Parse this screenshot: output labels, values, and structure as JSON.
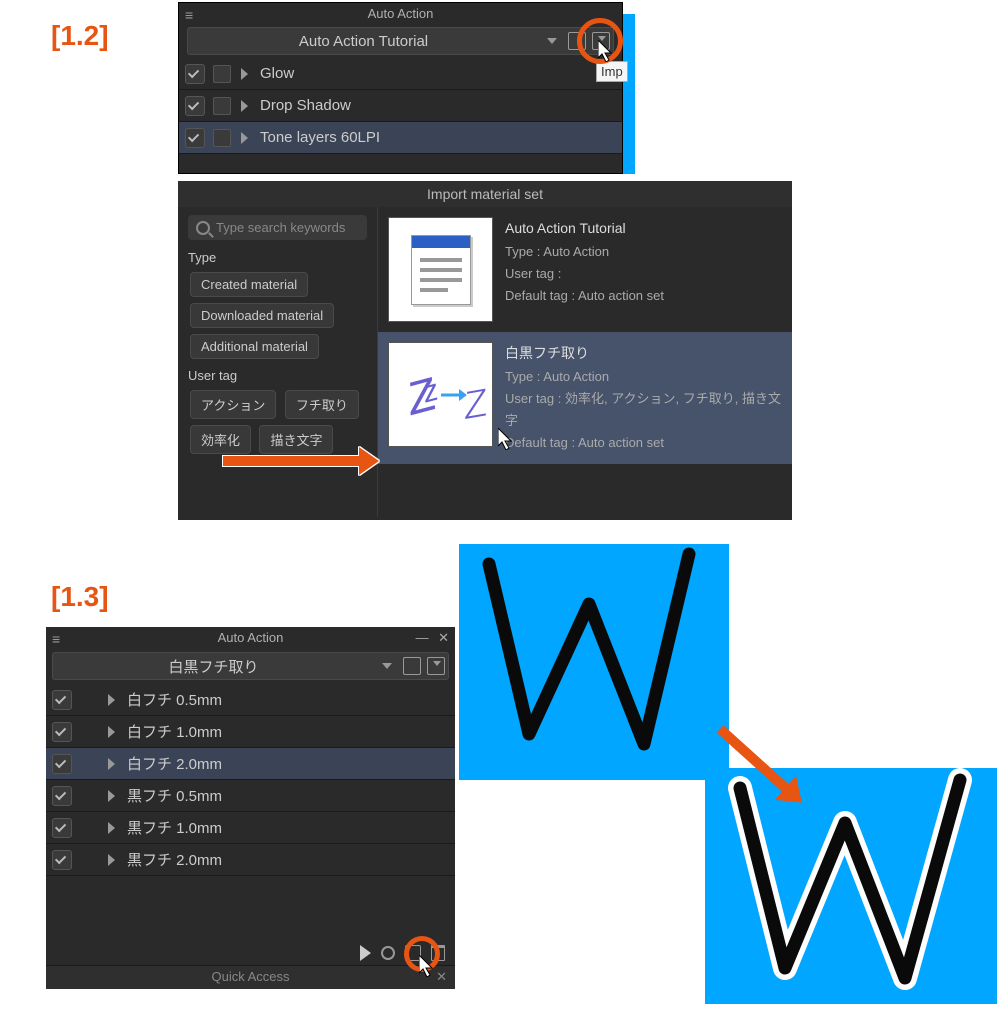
{
  "labels": {
    "step12": "[1.2]",
    "step13": "[1.3]"
  },
  "panel1": {
    "title": "Auto Action",
    "dropdown": "Auto Action Tutorial",
    "import_tooltip": "Imp",
    "rows": [
      "Glow",
      "Drop Shadow",
      "Tone layers 60LPI"
    ]
  },
  "panel2": {
    "title": "Import material set",
    "search_placeholder": "Type search keywords",
    "type_label": "Type",
    "type_tags": [
      "Created material",
      "Downloaded material",
      "Additional material"
    ],
    "usertag_label": "User tag",
    "user_tags": [
      "アクション",
      "フチ取り",
      "効率化",
      "描き文字"
    ],
    "materials": [
      {
        "title": "Auto Action Tutorial",
        "type": "Type : Auto Action",
        "usertag": "User tag :",
        "default": "Default tag : Auto action set"
      },
      {
        "title": "白黒フチ取り",
        "type": "Type : Auto Action",
        "usertag": "User tag : 効率化, アクション, フチ取り, 描き文字",
        "default": "Default tag : Auto action set"
      }
    ]
  },
  "panel3": {
    "title": "Auto Action",
    "dropdown": "白黒フチ取り",
    "rows": [
      "白フチ 0.5mm",
      "白フチ 1.0mm",
      "白フチ 2.0mm",
      "黒フチ 0.5mm",
      "黒フチ 1.0mm",
      "黒フチ 2.0mm"
    ],
    "quick_access": "Quick Access"
  },
  "colors": {
    "accent": "#e85412",
    "blue": "#00a6ff"
  }
}
